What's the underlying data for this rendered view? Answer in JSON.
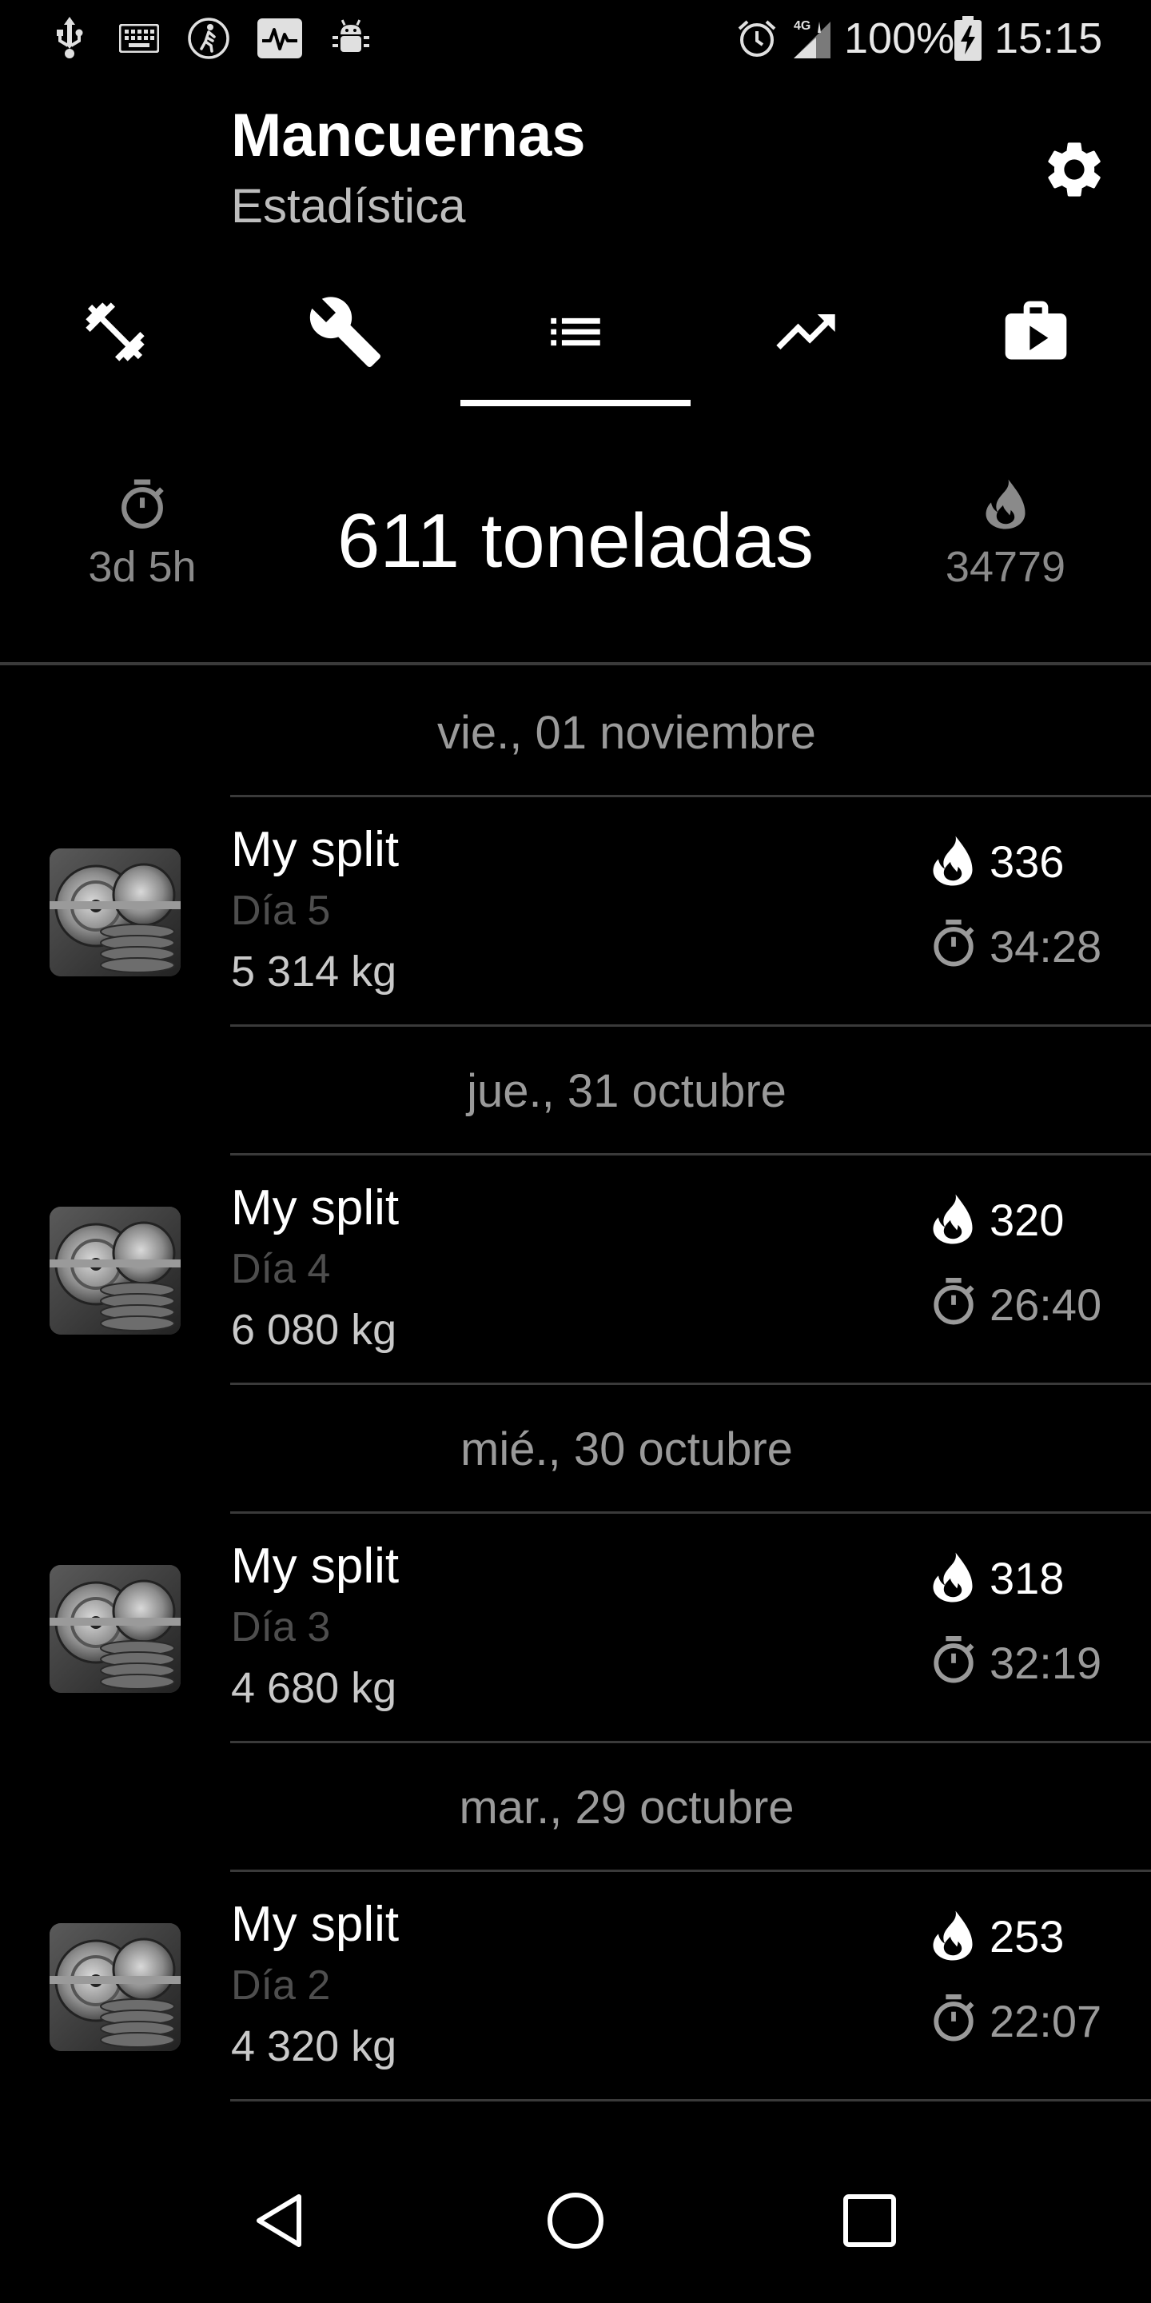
{
  "status_bar": {
    "battery": "100%",
    "time": "15:15",
    "network": "4G",
    "left_icons": [
      "usb-icon",
      "keyboard-icon",
      "walking-icon",
      "activity-icon",
      "android-debug-icon"
    ],
    "right_icons": [
      "alarm-icon",
      "signal-icon",
      "battery-charging-icon"
    ]
  },
  "header": {
    "title": "Mancuernas",
    "subtitle": "Estadística",
    "settings_icon": "gear-icon"
  },
  "tabs": [
    {
      "icon": "dumbbell-icon",
      "selected": false
    },
    {
      "icon": "wrench-icon",
      "selected": false
    },
    {
      "icon": "list-icon",
      "selected": true
    },
    {
      "icon": "trending-up-icon",
      "selected": false
    },
    {
      "icon": "briefcase-play-icon",
      "selected": false
    }
  ],
  "summary": {
    "duration": "3d 5h",
    "total": "611 toneladas",
    "calories": "34779"
  },
  "workouts": [
    {
      "date": "vie., 01 noviembre",
      "name": "My split",
      "day": "Día 5",
      "weight": "5 314 kg",
      "calories": "336",
      "duration": "34:28"
    },
    {
      "date": "jue., 31 octubre",
      "name": "My split",
      "day": "Día 4",
      "weight": "6 080 kg",
      "calories": "320",
      "duration": "26:40"
    },
    {
      "date": "mié., 30 octubre",
      "name": "My split",
      "day": "Día 3",
      "weight": "4 680 kg",
      "calories": "318",
      "duration": "32:19"
    },
    {
      "date": "mar., 29 octubre",
      "name": "My split",
      "day": "Día 2",
      "weight": "4 320 kg",
      "calories": "253",
      "duration": "22:07"
    }
  ],
  "nav_bar": {
    "back_icon": "back-triangle-icon",
    "home_icon": "home-circle-icon",
    "recents_icon": "recents-square-icon"
  }
}
